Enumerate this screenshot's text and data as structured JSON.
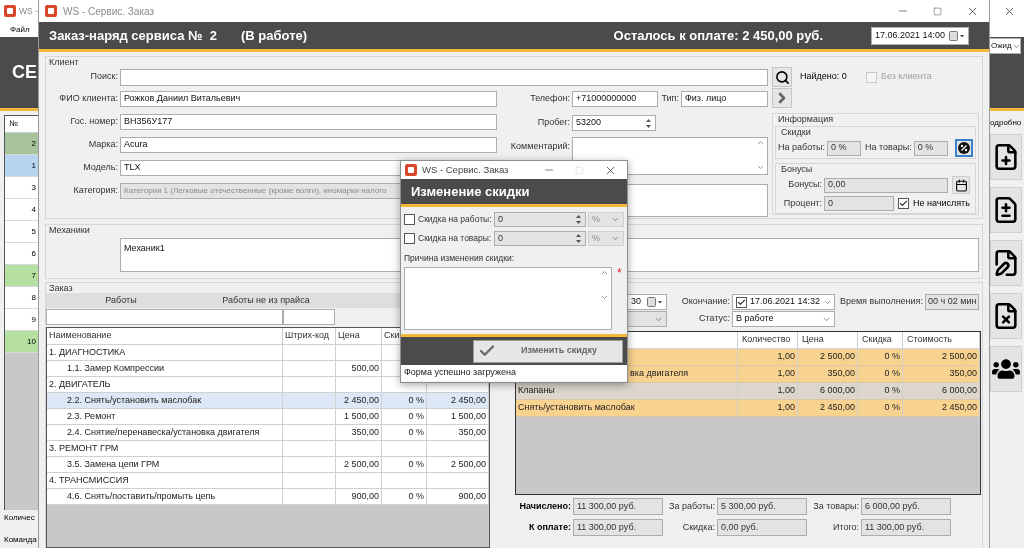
{
  "background_app": {
    "title": "WS -",
    "menu": [
      "Файл"
    ],
    "heading": "СЕ",
    "filter": "Ожид",
    "details_label": "одробно",
    "table": {
      "column": "№",
      "rows": [
        {
          "number": "2",
          "color": "#a6c39c"
        },
        {
          "number": "1",
          "color": "#b8d5f0"
        },
        {
          "number": "3",
          "color": "#ffffff"
        },
        {
          "number": "4",
          "color": "#ffffff"
        },
        {
          "number": "5",
          "color": "#ffffff"
        },
        {
          "number": "6",
          "color": "#ffffff"
        },
        {
          "number": "7",
          "color": "#b6e0a1"
        },
        {
          "number": "8",
          "color": "#ffffff"
        },
        {
          "number": "9",
          "color": "#ffffff"
        },
        {
          "number": "10",
          "color": "#b6e0a1"
        }
      ]
    },
    "footer_labels": [
      "Количес",
      "Команда"
    ],
    "side_buttons": [
      {
        "kind": "add"
      },
      {
        "kind": "add_remove"
      },
      {
        "kind": "edit"
      },
      {
        "kind": "delete"
      },
      {
        "kind": "people"
      }
    ]
  },
  "order_window": {
    "title": "WS - Сервис. Заказ",
    "heading": "Заказ-наряд сервиса №  2",
    "status": "(В работе)",
    "remaining": "Осталось к оплате: 2 450,00 руб.",
    "date": "17.06.2021 14:00",
    "client": {
      "legend": "Клиент",
      "search_label": "Поиск:",
      "found": "Найдено: 0",
      "no_client": {
        "label": "Без клиента",
        "checked": false,
        "disabled": true
      },
      "fields": [
        {
          "label": "ФИО клиента:",
          "value": "Рожков Даниил Витальевич",
          "disabled": false
        },
        {
          "label": "Гос. номер:",
          "value": "ВН356У177",
          "disabled": false
        },
        {
          "label": "Марка:",
          "value": "Acura",
          "disabled": false
        },
        {
          "label": "Модель:",
          "value": "TLX",
          "disabled": false
        },
        {
          "label": "Категория:",
          "value": "Категория 1 (Легковые отечественные (кроме волги), иномарки налого",
          "disabled": true
        }
      ],
      "phone": {
        "label": "Телефон:",
        "value": "+71000000000"
      },
      "type": {
        "label": "Тип:",
        "value": "Физ. лицо"
      },
      "mileage": {
        "label": "Пробег:",
        "value": "53200"
      },
      "comment_label": "Комментарий:",
      "info": {
        "legend": "Информация",
        "discounts": {
          "legend": "Скидки",
          "works_label": "На работы:",
          "works_value": "0 %",
          "goods_label": "На товары:",
          "goods_value": "0 %"
        },
        "bonuses": {
          "legend": "Бонусы",
          "bonus_label": "Бонусы:",
          "bonus_value": "0,00",
          "percent_label": "Процент:",
          "percent_value": "0",
          "no_accrue": {
            "label": "Не начислять",
            "checked": true
          }
        }
      }
    },
    "mechanics": {
      "legend": "Механики",
      "value": "Механик1"
    },
    "order": {
      "legend": "Заказ",
      "headers": [
        "Работы",
        "Работы не из прайса"
      ],
      "works_table": {
        "columns": [
          "Наименование",
          "Штрих-код",
          "Цена",
          "Ски"
        ],
        "rows": [
          {
            "kind": "group",
            "name": "1. ДИАГНОСТИКА",
            "selected": false
          },
          {
            "kind": "item",
            "name": "1.1. Замер Компрессии",
            "price": "500,00",
            "selected": false
          },
          {
            "kind": "group",
            "name": "2. ДВИГАТЕЛЬ",
            "selected": false
          },
          {
            "kind": "item",
            "name": "2.2. Снять/установить маслобак",
            "price": "2 450,00",
            "discount": "0 %",
            "cost": "2 450,00",
            "selected": true
          },
          {
            "kind": "item",
            "name": "2.3. Ремонт",
            "price": "1 500,00",
            "discount": "0 %",
            "cost": "1 500,00",
            "selected": false
          },
          {
            "kind": "item",
            "name": "2.4. Снятие/перенавеска/установка двигателя",
            "price": "350,00",
            "discount": "0 %",
            "cost": "350,00",
            "selected": false
          },
          {
            "kind": "group",
            "name": "3. РЕМОНТ ГРМ",
            "selected": false
          },
          {
            "kind": "item",
            "name": "3.5. Замена цепи ГРМ",
            "price": "2 500,00",
            "discount": "0 %",
            "cost": "2 500,00",
            "selected": false
          },
          {
            "kind": "group",
            "name": "4. ТРАНСМИССИЯ",
            "selected": false
          },
          {
            "kind": "item",
            "name": "4.6. Снять/поставить/промыть цепь",
            "price": "900,00",
            "discount": "0 %",
            "cost": "900,00",
            "selected": false
          }
        ]
      },
      "start_date": "30",
      "end": {
        "label": "Окончание:",
        "checked": true,
        "value": "17.06.2021 14:32"
      },
      "duration": {
        "label": "Время выполнения:",
        "value": "00 ч 02 мин"
      },
      "status": {
        "label": "Статус:",
        "value": "В работе"
      },
      "goods_table": {
        "columns": [
          "Количество",
          "Цена",
          "Скидка",
          "Стоимость"
        ],
        "rows": [
          {
            "quantity": "1,00",
            "price": "2 500,00",
            "discount": "0 %",
            "cost": "2 500,00",
            "color": "#f8d28f"
          },
          {
            "name": "вка двигателя",
            "partial": true,
            "quantity": "1,00",
            "price": "350,00",
            "discount": "0 %",
            "cost": "350,00",
            "color": "#f8d28f"
          },
          {
            "name": "Клапаны",
            "partial": false,
            "quantity": "1,00",
            "price": "6 000,00",
            "discount": "0 %",
            "cost": "6 000,00",
            "color": "#dcd6cd"
          },
          {
            "name": "Снять/установить маслобак",
            "partial": false,
            "quantity": "1,00",
            "price": "2 450,00",
            "discount": "0 %",
            "cost": "2 450,00",
            "color": "#f8d28f"
          }
        ]
      },
      "totals": [
        [
          {
            "label": "Начислено:",
            "value": "11 300,00 руб."
          },
          {
            "label": "За работы:",
            "value": "5 300,00 руб."
          },
          {
            "label": "За товары:",
            "value": "6 000,00 руб."
          }
        ],
        [
          {
            "label": "К оплате:",
            "value": "11 300,00 руб."
          },
          {
            "label": "Скидка:",
            "value": "0,00 руб."
          },
          {
            "label": "Итого:",
            "value": "11 300,00 руб."
          }
        ]
      ]
    }
  },
  "discount_dialog": {
    "title": "WS - Сервис. Заказ",
    "maximize_disabled": true,
    "heading": "Изменение скидки",
    "discounts": [
      {
        "label": "Скидка на работы:",
        "checked": false,
        "value": "0",
        "unit": "%",
        "unit_disabled": true
      },
      {
        "label": "Скидка на товары:",
        "checked": false,
        "value": "0",
        "unit": "%",
        "unit_disabled": true
      }
    ],
    "reason_label": "Причина изменения скидки:",
    "required_mark": "*",
    "button": "Изменить скидку",
    "status": "Форма успешно загружена"
  }
}
